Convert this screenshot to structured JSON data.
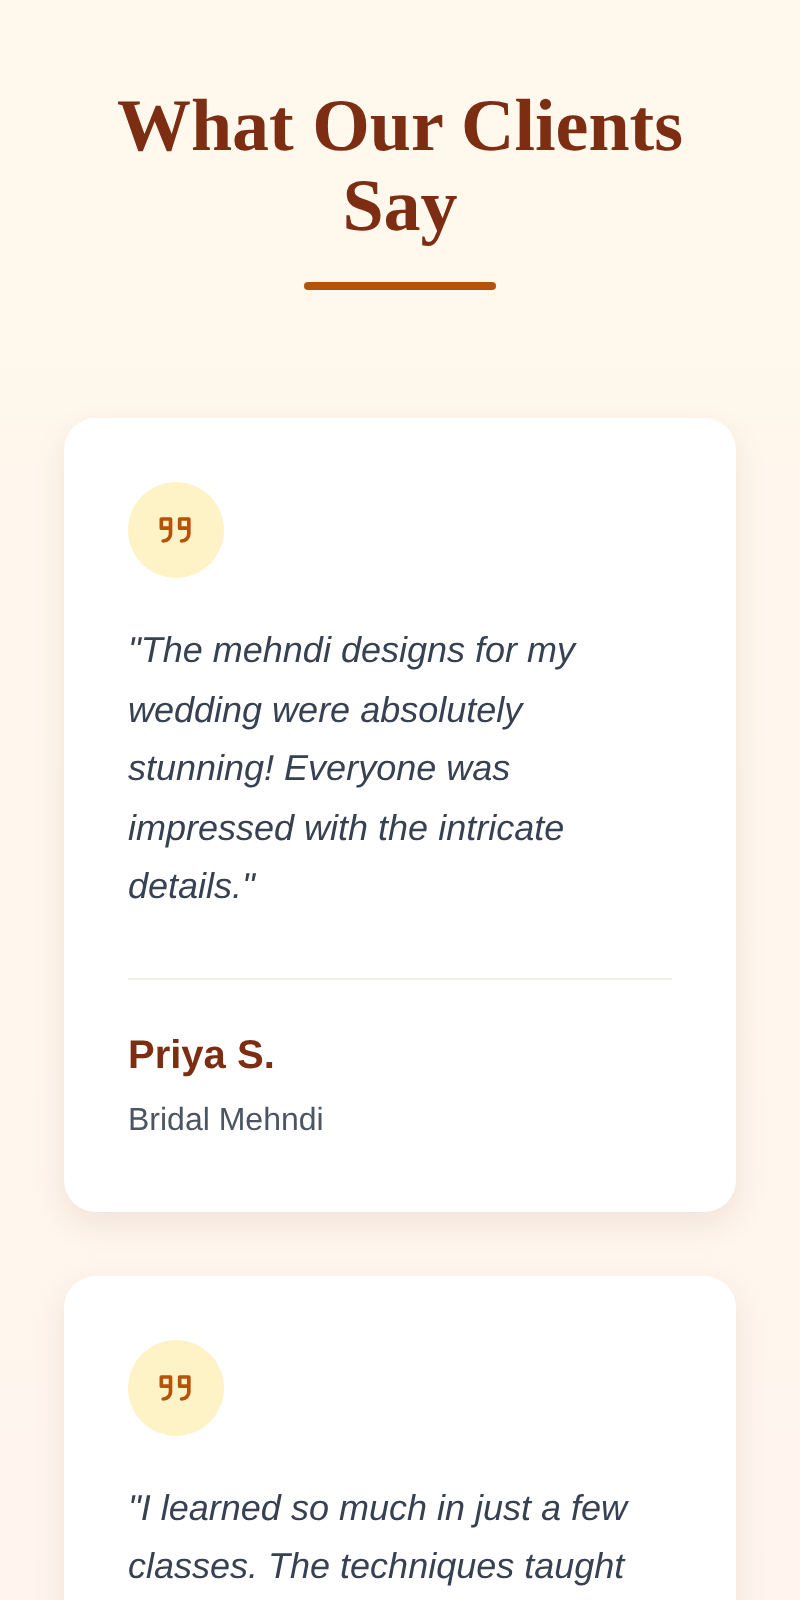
{
  "heading": "What Our Clients Say",
  "testimonials": [
    {
      "quote": "\"The mehndi designs for my wedding were absolutely stunning! Everyone was impressed with the intricate details.\"",
      "name": "Priya S.",
      "role": "Bridal Mehndi"
    },
    {
      "quote": "\"I learned so much in just a few classes. The techniques taught"
    }
  ]
}
